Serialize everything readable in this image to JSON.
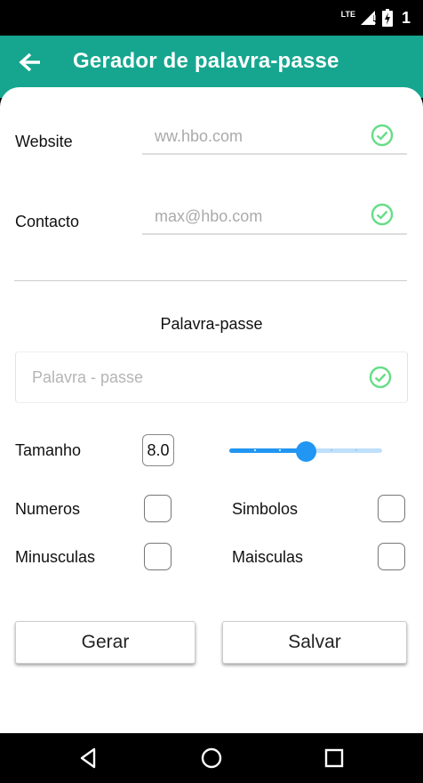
{
  "status_bar": {
    "network_label": "LTE",
    "time": "1"
  },
  "app_bar": {
    "title": "Gerador de palavra-passe",
    "back_icon": "arrow-left-icon",
    "background": "#16a68f"
  },
  "form": {
    "website": {
      "label": "Website",
      "placeholder": "ww.hbo.com"
    },
    "contact": {
      "label": "Contacto",
      "placeholder": "max@hbo.com"
    },
    "password_title": "Palavra-passe",
    "password": {
      "placeholder": "Palavra - passe"
    },
    "valid_icon": "check-circle-icon",
    "valid_color": "#66dd88"
  },
  "length": {
    "label": "Tamanho",
    "value": "8.0",
    "slider_fraction": 0.5,
    "slider_divisions": 6,
    "accent": "#2196f3"
  },
  "options": [
    {
      "label": "Numeros",
      "checked": false
    },
    {
      "label": "Simbolos",
      "checked": false
    },
    {
      "label": "Minusculas",
      "checked": false
    },
    {
      "label": "Maisculas",
      "checked": false
    }
  ],
  "actions": {
    "generate": "Gerar",
    "save": "Salvar"
  },
  "nav_bar": {
    "back": "back-triangle-icon",
    "home": "home-circle-icon",
    "recents": "recents-square-icon"
  }
}
